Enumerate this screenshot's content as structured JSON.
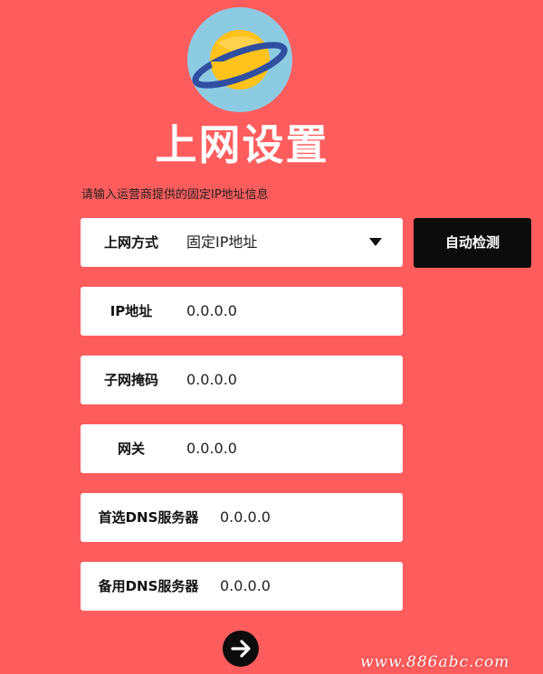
{
  "title": "上网设置",
  "subtitle": "请输入运营商提供的固定IP地址信息",
  "connection": {
    "label": "上网方式",
    "value": "固定IP地址"
  },
  "detect_button": "自动检测",
  "fields": [
    {
      "label": "IP地址",
      "value": "0.0.0.0"
    },
    {
      "label": "子网掩码",
      "value": "0.0.0.0"
    },
    {
      "label": "网关",
      "value": "0.0.0.0"
    },
    {
      "label": "首选DNS服务器",
      "value": "0.0.0.0"
    },
    {
      "label": "备用DNS服务器",
      "value": "0.0.0.0"
    }
  ],
  "watermark": "www.886abc.com",
  "colors": {
    "background": "#ff5d5d",
    "button": "#0c0c0c",
    "logo_bg": "#8dcbe3",
    "planet": "#ffc21a"
  },
  "icons": {
    "logo": "planet-logo-icon",
    "dropdown": "caret-down-icon",
    "next": "arrow-right-icon"
  }
}
